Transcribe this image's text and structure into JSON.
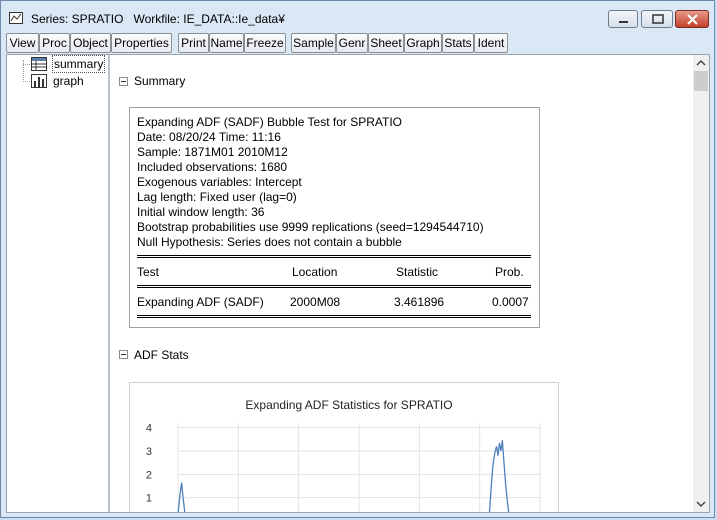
{
  "window": {
    "title": "Series: SPRATIO",
    "workfile": "Workfile: IE_DATA::Ie_data¥"
  },
  "toolbar": {
    "buttons": [
      "View",
      "Proc",
      "Object",
      "Properties",
      "Print",
      "Name",
      "Freeze",
      "Sample",
      "Genr",
      "Sheet",
      "Graph",
      "Stats",
      "Ident"
    ]
  },
  "tree": {
    "items": [
      {
        "label": "summary",
        "icon": "table-icon"
      },
      {
        "label": "graph",
        "icon": "bar-chart-icon"
      }
    ]
  },
  "summary_section": {
    "title": "Summary",
    "lines": [
      "Expanding ADF (SADF) Bubble Test for SPRATIO",
      "Date: 08/20/24   Time: 11:16",
      "Sample: 1871M01 2010M12",
      "Included observations: 1680",
      "Exogenous variables: Intercept",
      "Lag length: Fixed user (lag=0)",
      "Initial window length: 36",
      "Bootstrap probabilities use 9999 replications (seed=1294544710)",
      "Null Hypothesis: Series does not contain a bubble"
    ],
    "table": {
      "headers": [
        "Test",
        "Location",
        "Statistic",
        "Prob."
      ],
      "rows": [
        [
          "Expanding ADF (SADF)",
          "2000M08",
          "3.461896",
          "0.0007"
        ]
      ]
    }
  },
  "adf_section": {
    "title": "ADF Stats"
  },
  "chart_data": {
    "type": "line",
    "title": "Expanding ADF Statistics for SPRATIO",
    "yticks": [
      "4",
      "3",
      "2",
      "1"
    ],
    "ylim": [
      0,
      4.2
    ],
    "grid": true,
    "series": [
      {
        "color": "#4f81bd",
        "x": [
          0,
          0.6,
          1.0,
          1.4,
          2.0,
          86,
          86.5,
          87,
          87.5,
          88,
          88.4,
          88.8,
          89.2,
          89.6,
          90,
          90.5,
          91,
          91.5
        ],
        "values": [
          0.3,
          1.2,
          1.65,
          1.0,
          0.2,
          0.3,
          1.4,
          2.4,
          2.9,
          3.2,
          2.8,
          3.35,
          3.0,
          3.46,
          2.6,
          1.6,
          0.8,
          0.2
        ]
      }
    ],
    "xlim": [
      0,
      100
    ]
  }
}
